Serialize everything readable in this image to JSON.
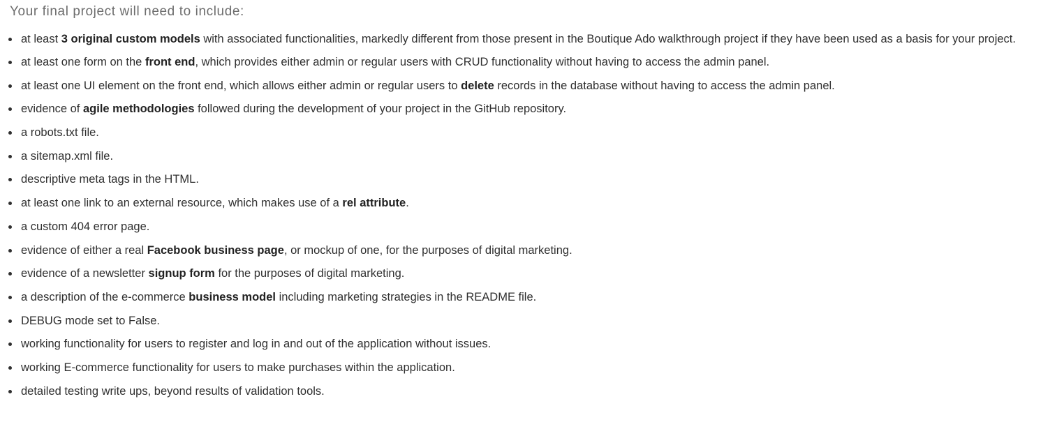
{
  "heading": "Your final project will need to include:",
  "requirements": [
    {
      "parts": [
        {
          "text": "at least ",
          "bold": false
        },
        {
          "text": "3 original custom models",
          "bold": true
        },
        {
          "text": " with associated functionalities, markedly different from those present in the Boutique Ado walkthrough project if they have been used as a basis for your project.",
          "bold": false
        }
      ]
    },
    {
      "parts": [
        {
          "text": "at least one form on the ",
          "bold": false
        },
        {
          "text": "front end",
          "bold": true
        },
        {
          "text": ", which provides either admin or regular users with CRUD functionality without having to access the admin panel.",
          "bold": false
        }
      ]
    },
    {
      "parts": [
        {
          "text": "at least one UI element on the front end, which allows either admin or regular users to ",
          "bold": false
        },
        {
          "text": "delete",
          "bold": true
        },
        {
          "text": " records in the database without having to access the admin panel.",
          "bold": false
        }
      ]
    },
    {
      "parts": [
        {
          "text": "evidence of ",
          "bold": false
        },
        {
          "text": "agile methodologies",
          "bold": true
        },
        {
          "text": " followed during the development of your project in the GitHub repository.",
          "bold": false
        }
      ]
    },
    {
      "parts": [
        {
          "text": "a robots.txt file.",
          "bold": false
        }
      ]
    },
    {
      "parts": [
        {
          "text": "a sitemap.xml file.",
          "bold": false
        }
      ]
    },
    {
      "parts": [
        {
          "text": "descriptive meta tags in the HTML.",
          "bold": false
        }
      ]
    },
    {
      "parts": [
        {
          "text": "at least one link to an external resource, which makes use of a ",
          "bold": false
        },
        {
          "text": "rel attribute",
          "bold": true
        },
        {
          "text": ".",
          "bold": false
        }
      ]
    },
    {
      "parts": [
        {
          "text": "a custom 404 error page.",
          "bold": false
        }
      ]
    },
    {
      "parts": [
        {
          "text": "evidence of either a real ",
          "bold": false
        },
        {
          "text": "Facebook business page",
          "bold": true
        },
        {
          "text": ", or mockup of one, for the purposes of digital marketing.",
          "bold": false
        }
      ]
    },
    {
      "parts": [
        {
          "text": "evidence of a newsletter ",
          "bold": false
        },
        {
          "text": "signup form",
          "bold": true
        },
        {
          "text": " for the purposes of digital marketing.",
          "bold": false
        }
      ]
    },
    {
      "parts": [
        {
          "text": "a description of the e-commerce ",
          "bold": false
        },
        {
          "text": "business model",
          "bold": true
        },
        {
          "text": " including marketing strategies in the README file.",
          "bold": false
        }
      ]
    },
    {
      "parts": [
        {
          "text": "DEBUG mode set to False.",
          "bold": false
        }
      ]
    },
    {
      "parts": [
        {
          "text": "working functionality for users to register and log in and out of the application without issues.",
          "bold": false
        }
      ]
    },
    {
      "parts": [
        {
          "text": "working E-commerce functionality for users to make purchases within the application.",
          "bold": false
        }
      ]
    },
    {
      "parts": [
        {
          "text": "detailed testing write ups, beyond results of validation tools.",
          "bold": false
        }
      ]
    }
  ]
}
